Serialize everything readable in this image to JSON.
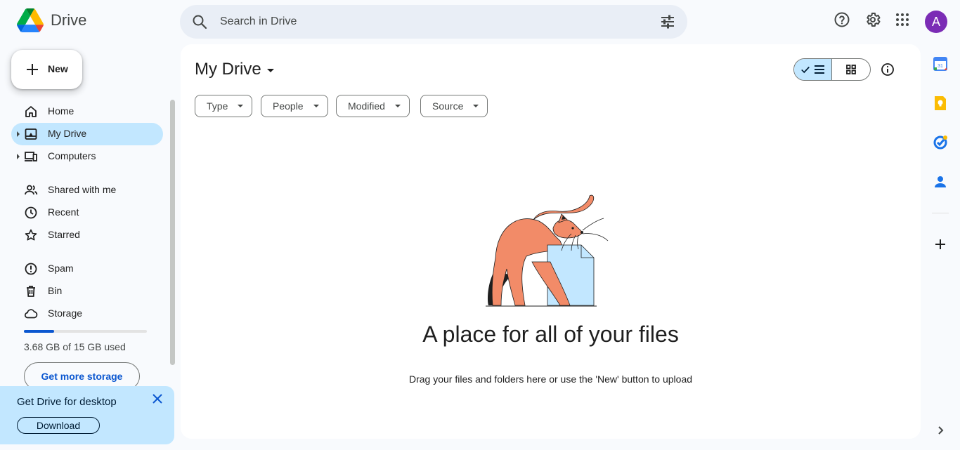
{
  "app": {
    "name": "Drive"
  },
  "search": {
    "placeholder": "Search in Drive"
  },
  "header": {
    "avatar_letter": "A"
  },
  "sidebar": {
    "new_label": "New",
    "items": [
      {
        "label": "Home",
        "icon": "home-icon"
      },
      {
        "label": "My Drive",
        "icon": "my-drive-icon",
        "active": true
      },
      {
        "label": "Computers",
        "icon": "computers-icon"
      },
      {
        "label": "Shared with me",
        "icon": "shared-icon"
      },
      {
        "label": "Recent",
        "icon": "clock-icon"
      },
      {
        "label": "Starred",
        "icon": "star-icon"
      },
      {
        "label": "Spam",
        "icon": "spam-icon"
      },
      {
        "label": "Bin",
        "icon": "bin-icon"
      },
      {
        "label": "Storage",
        "icon": "cloud-icon"
      }
    ],
    "storage": {
      "used_text": "3.68 GB of 15 GB used",
      "fraction": 0.245
    },
    "get_more_storage": "Get more storage"
  },
  "promo": {
    "title": "Get Drive for desktop",
    "download_label": "Download"
  },
  "main": {
    "title": "My Drive",
    "filters": [
      "Type",
      "People",
      "Modified",
      "Source"
    ],
    "empty_title": "A place for all of your files",
    "empty_subtitle": "Drag your files and folders here or use the 'New' button to upload"
  },
  "right_panel": {
    "apps": [
      "calendar-icon",
      "keep-icon",
      "tasks-icon",
      "contacts-icon"
    ]
  },
  "colors": {
    "accent": "#0b57d0",
    "selected": "#c2e7ff",
    "background": "#f8fafd"
  }
}
